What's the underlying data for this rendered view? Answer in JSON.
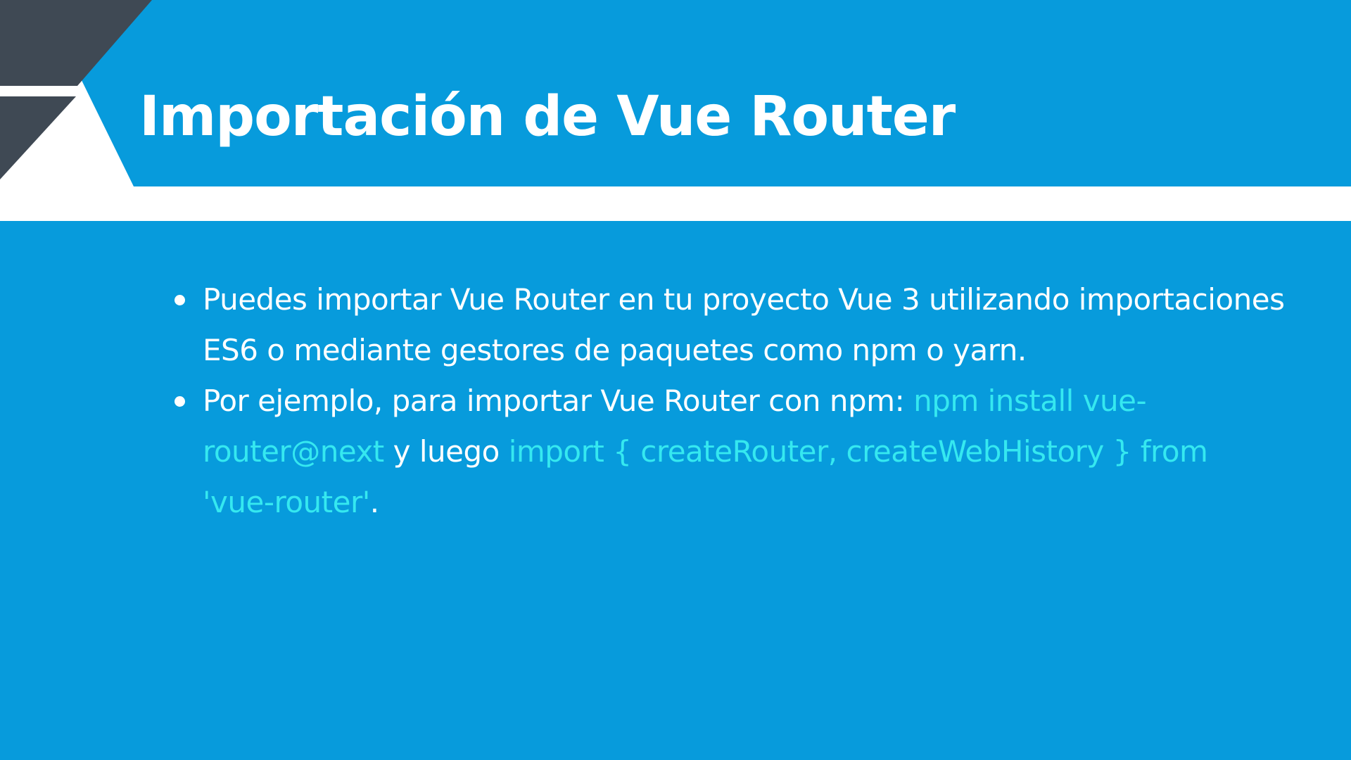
{
  "slide": {
    "title": "Importación de Vue Router",
    "bullets": [
      {
        "segments": [
          {
            "text": "Puedes importar Vue Router en tu proyecto Vue 3 utilizando importaciones ES6 o mediante gestores de paquetes como npm o yarn.",
            "style": "text"
          }
        ]
      },
      {
        "segments": [
          {
            "text": "Por ejemplo, para importar Vue Router con npm: ",
            "style": "text"
          },
          {
            "text": "npm install vue-router@next",
            "style": "code"
          },
          {
            "text": " y luego ",
            "style": "text"
          },
          {
            "text": "import { createRouter, createWebHistory } from 'vue-router'",
            "style": "code"
          },
          {
            "text": ".",
            "style": "text"
          }
        ]
      }
    ]
  },
  "colors": {
    "primary_blue": "#079bdc",
    "dark_accent": "#3f4954",
    "code_highlight": "#35e8f0",
    "text": "#ffffff"
  }
}
